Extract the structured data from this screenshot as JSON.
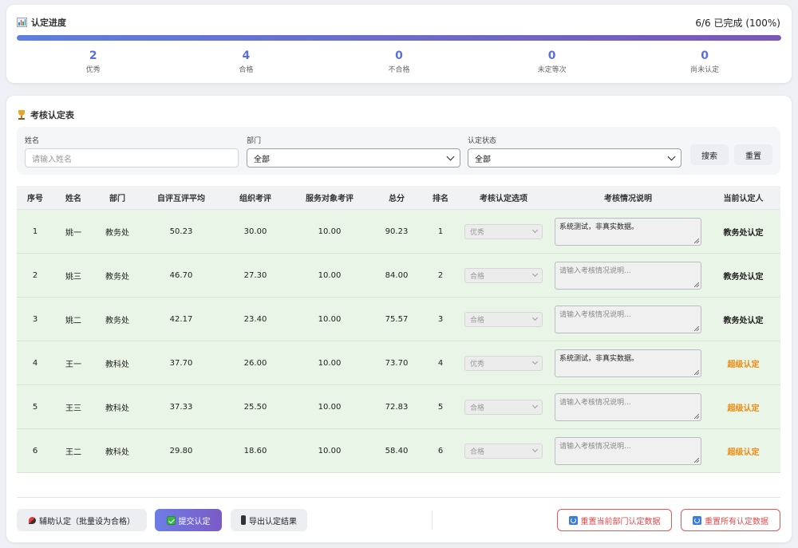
{
  "progress": {
    "title": "认定进度",
    "summary": "6/6 已完成 (100%)",
    "percent": 100,
    "stats": [
      {
        "value": "2",
        "label": "优秀"
      },
      {
        "value": "4",
        "label": "合格"
      },
      {
        "value": "0",
        "label": "不合格"
      },
      {
        "value": "0",
        "label": "未定等次"
      },
      {
        "value": "0",
        "label": "尚未认定"
      }
    ],
    "icon": "bar-chart-icon"
  },
  "main": {
    "title": "考核认定表",
    "icon": "trophy-icon"
  },
  "filters": {
    "name_label": "姓名",
    "name_placeholder": "请输入姓名",
    "dept_label": "部门",
    "dept_value": "全部",
    "status_label": "认定状态",
    "status_value": "全部",
    "search_label": "搜索",
    "reset_label": "重置"
  },
  "table": {
    "headers": [
      "序号",
      "姓名",
      "部门",
      "自评互评平均",
      "组织考评",
      "服务对象考评",
      "总分",
      "排名",
      "考核认定选项",
      "考核情况说明",
      "当前认定人"
    ],
    "rows": [
      {
        "no": "1",
        "name": "姚一",
        "dept": "教务处",
        "self": "50.23",
        "org": "30.00",
        "svc": "10.00",
        "total": "90.23",
        "rank": "1",
        "option": "优秀",
        "note": "系统测试，非真实数据。",
        "note_is_placeholder": false,
        "auth": "教务处认定",
        "auth_super": false
      },
      {
        "no": "2",
        "name": "姚三",
        "dept": "教务处",
        "self": "46.70",
        "org": "27.30",
        "svc": "10.00",
        "total": "84.00",
        "rank": "2",
        "option": "合格",
        "note": "请输入考核情况说明...",
        "note_is_placeholder": true,
        "auth": "教务处认定",
        "auth_super": false
      },
      {
        "no": "3",
        "name": "姚二",
        "dept": "教务处",
        "self": "42.17",
        "org": "23.40",
        "svc": "10.00",
        "total": "75.57",
        "rank": "3",
        "option": "合格",
        "note": "请输入考核情况说明...",
        "note_is_placeholder": true,
        "auth": "教务处认定",
        "auth_super": false
      },
      {
        "no": "4",
        "name": "王一",
        "dept": "教科处",
        "self": "37.70",
        "org": "26.00",
        "svc": "10.00",
        "total": "73.70",
        "rank": "4",
        "option": "优秀",
        "note": "系统测试，非真实数据。",
        "note_is_placeholder": false,
        "auth": "超级认定",
        "auth_super": true
      },
      {
        "no": "5",
        "name": "王三",
        "dept": "教科处",
        "self": "37.33",
        "org": "25.50",
        "svc": "10.00",
        "total": "72.83",
        "rank": "5",
        "option": "合格",
        "note": "请输入考核情况说明...",
        "note_is_placeholder": true,
        "auth": "超级认定",
        "auth_super": true
      },
      {
        "no": "6",
        "name": "王二",
        "dept": "教科处",
        "self": "29.80",
        "org": "18.60",
        "svc": "10.00",
        "total": "58.40",
        "rank": "6",
        "option": "合格",
        "note": "请输入考核情况说明...",
        "note_is_placeholder": true,
        "auth": "超级认定",
        "auth_super": true
      }
    ]
  },
  "actions": {
    "assist_label": "辅助认定（批量设为合格）",
    "submit_label": "提交认定",
    "export_label": "导出认定结果",
    "reset_dept_label": "重置当前部门认定数据",
    "reset_all_label": "重置所有认定数据"
  },
  "colors": {
    "accent": "#5b6fe0",
    "row_bg": "#e9f5e6",
    "super_auth": "#f08a10",
    "danger": "#e04848"
  }
}
